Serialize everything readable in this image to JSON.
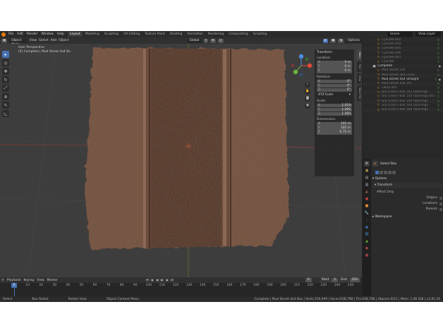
{
  "topbar": {
    "menus": [
      "File",
      "Edit",
      "Render",
      "Window",
      "Help"
    ],
    "workspaces": [
      "Layout",
      "Modeling",
      "Sculpting",
      "UV Editing",
      "Texture Paint",
      "Shading",
      "Animation",
      "Rendering",
      "Compositing",
      "Scripting"
    ],
    "active_workspace": "Layout",
    "scene": "Scene",
    "view_layer": "View Layer"
  },
  "viewport_header": {
    "mode": "Object Mode",
    "menus": [
      "View",
      "Select",
      "Add",
      "Object"
    ],
    "orientation": "Global",
    "options": "Options"
  },
  "viewport_info": {
    "line1": "User Perspective",
    "line2": "(0) Complete | Mud Street 4x4 Bo"
  },
  "npanel": {
    "header": "Transform",
    "location_label": "Location:",
    "location": [
      [
        "X",
        "0 m"
      ],
      [
        "Y",
        "0 m"
      ],
      [
        "Z",
        "0 m"
      ]
    ],
    "rotation_label": "Rotation:",
    "rotation": [
      [
        "X",
        "0°"
      ],
      [
        "Y",
        "0°"
      ],
      [
        "Z",
        "0°"
      ]
    ],
    "rotation_mode": "XYZ Euler",
    "scale_label": "Scale:",
    "scale": [
      [
        "X",
        "1.019"
      ],
      [
        "Y",
        "1.000"
      ],
      [
        "Z",
        "1.000"
      ]
    ],
    "dimensions_label": "Dimensions:",
    "dimensions": [
      [
        "X",
        "102 m"
      ],
      [
        "Y",
        "102 m"
      ],
      [
        "Z",
        "6.75 m"
      ]
    ],
    "tabs": [
      "Item",
      "Tool",
      "View",
      "Mesh Tile"
    ]
  },
  "outliner": {
    "rows": [
      {
        "name": "Cylinder.002",
        "dim": true
      },
      {
        "name": "Cylinder.003",
        "dim": true
      },
      {
        "name": "Cylinder.005",
        "dim": true
      },
      {
        "name": "Cylinder.006",
        "dim": true
      },
      {
        "name": "Cylinder.007",
        "dim": true
      },
      {
        "name": "Cylinder",
        "dim": true
      },
      {
        "name": "Complete",
        "dim": false,
        "collection": true
      },
      {
        "name": "Mud Street 2x4",
        "dim": true
      },
      {
        "name": "Mud Street 4x4 Cross",
        "dim": true
      },
      {
        "name": "Mud Street 4x4 Straight",
        "dim": false
      },
      {
        "name": "Mud Street 4x4 Tee",
        "dim": true
      },
      {
        "name": "Lamp.001",
        "dim": true
      },
      {
        "name": "Dry Grass Floor 2x2 Openings",
        "dim": true
      },
      {
        "name": "Dry Grass Floor 2x4 Openings.001",
        "dim": true
      },
      {
        "name": "Dry Grass Floor 2x4 Openings",
        "dim": true
      },
      {
        "name": "Dry Grass Floor 4x4 Openings",
        "dim": true
      },
      {
        "name": "Dry Grass Floor 4x4 Openings",
        "dim": true
      }
    ]
  },
  "properties": {
    "tool_name": "Select Box",
    "options_label": "Options",
    "transform_label": "Transform",
    "affect_only_label": "Affect Only",
    "origins_label": "Origins",
    "locations_label": "Locations",
    "parents_label": "Parents",
    "workspace_label": "Workspace"
  },
  "timeline": {
    "menus": [
      "Playback",
      "Keying",
      "View",
      "Marker"
    ],
    "current_frame": "0",
    "start_label": "Start",
    "start": "1",
    "end_label": "End",
    "end": "250",
    "frame_display": "0",
    "ticks": [
      "0",
      "10",
      "20",
      "30",
      "40",
      "50",
      "60",
      "70",
      "80",
      "90",
      "100",
      "110",
      "120",
      "130",
      "140",
      "150",
      "160",
      "170",
      "180",
      "190",
      "200",
      "210",
      "220",
      "230",
      "240",
      "250"
    ]
  },
  "statusbar": {
    "select": "Select",
    "box_select": "Box Select",
    "rotate_view": "Rotate View",
    "context_menu": "Object Context Menu",
    "stats": "Complete | Mud Street 4x4 Box | Verts:319,409 | Faces:638,798 | Tris:638,798 | Objects:0/21 | Mem: 1.06 GiB | v2.81.16"
  },
  "colors": {
    "accent": "#4772b3",
    "orange": "#e87d0d",
    "viewport_bg": "#3d3d3d",
    "mud": "#7a5846"
  }
}
